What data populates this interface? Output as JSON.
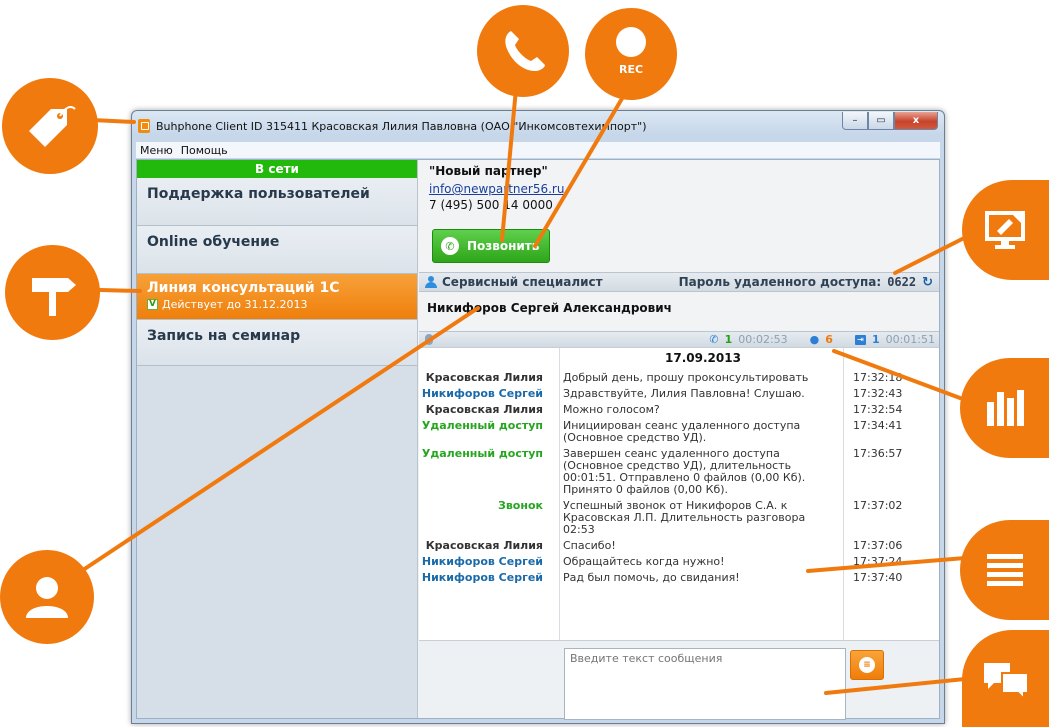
{
  "window": {
    "title": "Buhphone Client ID 315411 Красовская Лилия Павловна (ОАО \"Инкомсовтехимпорт\")",
    "buttons": {
      "minimize": "–",
      "maximize": "▭",
      "close": "x"
    }
  },
  "menu": {
    "items": [
      "Меню",
      "Помощь"
    ]
  },
  "left": {
    "status": "В сети",
    "items": [
      {
        "label": "Поддержка пользователей"
      },
      {
        "label": "Online обучение"
      },
      {
        "label": "Линия консультаций 1С",
        "sub": "Действует до 31.12.2013",
        "check": "V"
      },
      {
        "label": "Запись на семинар"
      }
    ]
  },
  "contact": {
    "name": "\"Новый партнер\"",
    "email": "info@newpartner56.ru",
    "phone": "7 (495) 500 14 0000",
    "call_label": "Позвонить"
  },
  "specialist_bar": {
    "label": "Сервисный специалист",
    "password_label": "Пароль удаленного доступа:",
    "password_value": "0622",
    "refresh": "↻"
  },
  "specialist": {
    "name": "Никифоров Сергей Александрович"
  },
  "stats": {
    "calls": "1",
    "call_time": "00:02:53",
    "messages": "6",
    "remote": "1",
    "remote_time": "00:01:51"
  },
  "chat": {
    "date": "17.09.2013",
    "rows": [
      {
        "who": "Красовская Лилия",
        "color": "dark",
        "msg": "Добрый день, прошу проконсультировать",
        "time": "17:32:18"
      },
      {
        "who": "Никифоров Сергей",
        "color": "blue",
        "msg": "Здравствуйте, Лилия Павловна! Слушаю.",
        "time": "17:32:43"
      },
      {
        "who": "Красовская Лилия",
        "color": "dark",
        "msg": "Можно голосом?",
        "time": "17:32:54"
      },
      {
        "who": "Удаленный доступ",
        "color": "green",
        "msg": "Инициирован сеанс удаленного доступа (Основное средство УД).",
        "time": "17:34:41"
      },
      {
        "who": "Удаленный доступ",
        "color": "green",
        "msg": "Завершен сеанс удаленного доступа (Основное средство УД), длительность 00:01:51. Отправлено 0 файлов (0,00 Кб). Принято 0 файлов (0,00 Кб).",
        "time": "17:36:57"
      },
      {
        "who": "Звонок",
        "color": "green",
        "msg": "Успешный звонок от Никифоров С.А. к Красовская Л.П. Длительность разговора 02:53",
        "time": "17:37:02"
      },
      {
        "who": "Красовская Лилия",
        "color": "dark",
        "msg": "Спасибо!",
        "time": "17:37:06"
      },
      {
        "who": "Никифоров Сергей",
        "color": "blue",
        "msg": "Обращайтесь когда нужно!",
        "time": "17:37:24"
      },
      {
        "who": "Никифоров Сергей",
        "color": "blue",
        "msg": "Рад был помочь, до свидания!",
        "time": "17:37:40"
      }
    ]
  },
  "input": {
    "placeholder": "Введите текст сообщения"
  },
  "callout_labels": {
    "rec": "REC"
  },
  "colors": {
    "accent": "#f07a0e",
    "online": "#22b80c",
    "call_green": "#2ea51a"
  }
}
